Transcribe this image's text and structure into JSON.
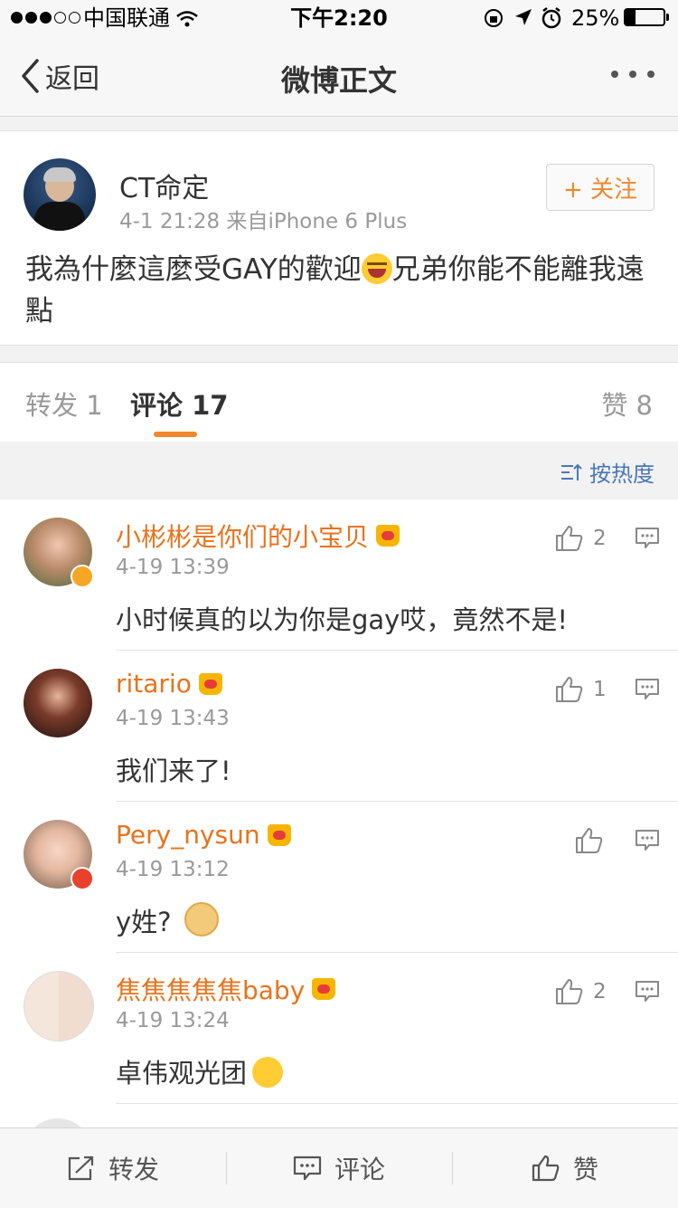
{
  "status": {
    "carrier": "中国联通",
    "time": "下午2:20",
    "battery": "25%",
    "battery_level": 0.25
  },
  "nav": {
    "back_label": "返回",
    "title": "微博正文"
  },
  "post": {
    "user": "CT命定",
    "meta": "4-1 21:28  来自iPhone 6 Plus",
    "follow_label": "+ 关注",
    "text_part1": "我為什麼這麼受GAY的歡迎",
    "text_part2": "兄弟你能不能離我遠點"
  },
  "tabs": {
    "reposts": "转发 1",
    "comments": "评论 17",
    "likes": "赞 8"
  },
  "sort": {
    "label": "按热度"
  },
  "comments": [
    {
      "name": "小彬彬是你们的小宝贝",
      "time": "4-19 13:39",
      "text": "小时候真的以为你是gay哎，竟然不是!",
      "likes": "2"
    },
    {
      "name": "ritario",
      "time": "4-19 13:43",
      "text": "我们来了!",
      "likes": "1"
    },
    {
      "name": "Pery_nysun",
      "time": "4-19 13:12",
      "text": "y姓?",
      "likes": ""
    },
    {
      "name": "焦焦焦焦焦baby",
      "time": "4-19 13:24",
      "text": "卓伟观光团",
      "likes": "2"
    }
  ],
  "toolbar": {
    "repost": "转发",
    "comment": "评论",
    "like": "赞"
  },
  "colors": {
    "accent_orange": "#f2862a",
    "username_orange": "#e8731c",
    "link_blue": "#4a78b5"
  },
  "icons": [
    "wifi-icon",
    "lock-rotation-icon",
    "location-icon",
    "alarm-icon",
    "battery-icon",
    "back-chevron-icon",
    "more-dots-icon",
    "sort-icon",
    "thumbs-up-icon",
    "reply-icon",
    "repost-icon",
    "comment-icon",
    "like-icon",
    "crown-icon",
    "laugh-emoji-icon",
    "doge-emoji-icon",
    "tongue-emoji-icon"
  ]
}
